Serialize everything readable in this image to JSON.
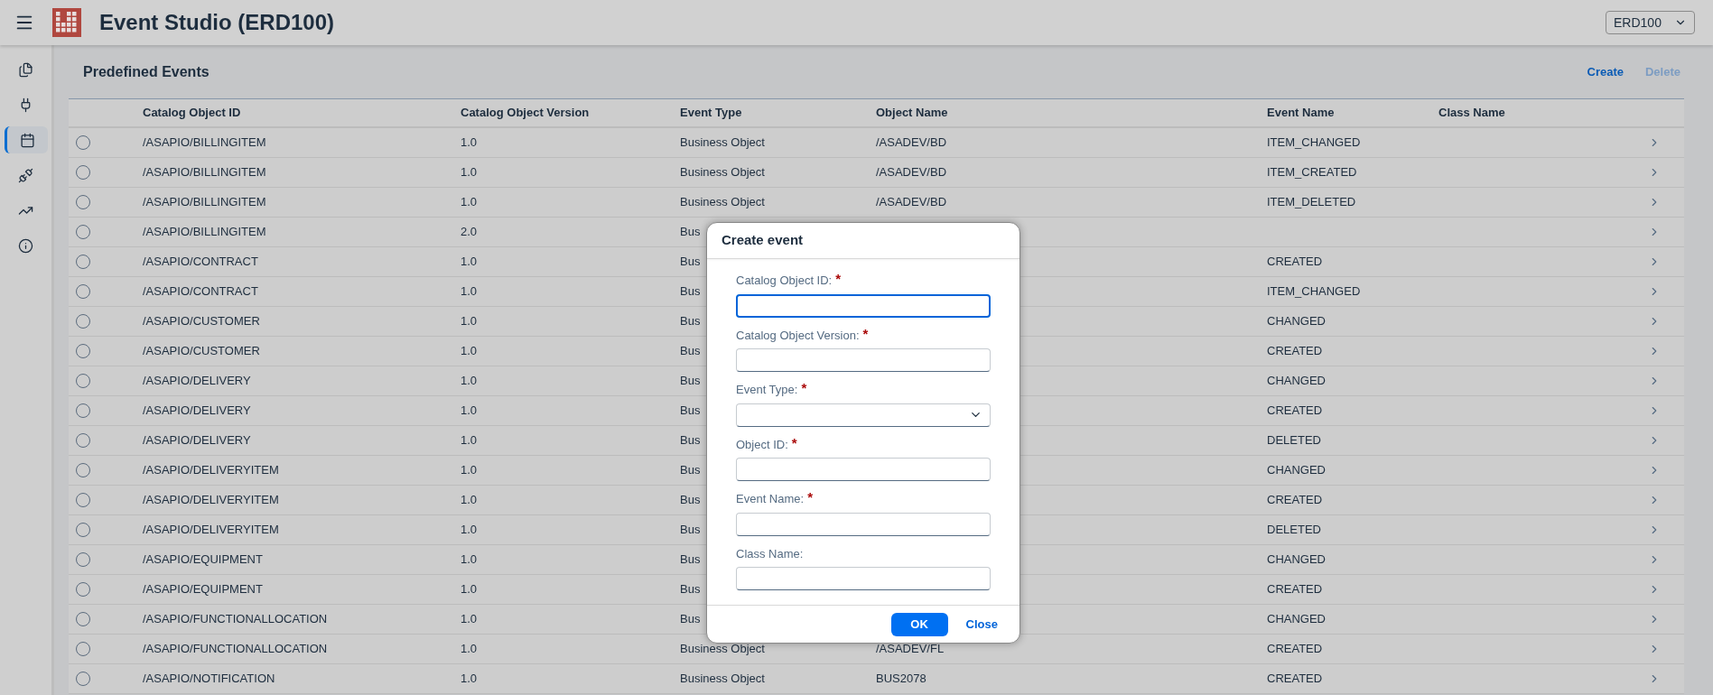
{
  "header": {
    "title": "Event Studio (ERD100)",
    "system": "ERD100"
  },
  "sidebar": {
    "items": [
      {
        "selected": false
      },
      {
        "selected": false
      },
      {
        "selected": true
      },
      {
        "selected": false
      },
      {
        "selected": false
      },
      {
        "selected": false
      }
    ]
  },
  "panel": {
    "title": "Predefined Events",
    "actions": [
      {
        "label": "Create",
        "disabled": false
      },
      {
        "label": "Delete",
        "disabled": true
      }
    ]
  },
  "table": {
    "columns": [
      "Catalog Object ID",
      "Catalog Object Version",
      "Event Type",
      "Object Name",
      "Event Name",
      "Class Name"
    ],
    "rows": [
      {
        "selected": false,
        "catalog_object_id": "/ASAPIO/BILLINGITEM",
        "version": "1.0",
        "event_type": "Business Object",
        "object_name": "/ASADEV/BD",
        "event_name": "ITEM_CHANGED"
      },
      {
        "selected": false,
        "catalog_object_id": "/ASAPIO/BILLINGITEM",
        "version": "1.0",
        "event_type": "Business Object",
        "object_name": "/ASADEV/BD",
        "event_name": "ITEM_CREATED"
      },
      {
        "selected": false,
        "catalog_object_id": "/ASAPIO/BILLINGITEM",
        "version": "1.0",
        "event_type": "Business Object",
        "object_name": "/ASADEV/BD",
        "event_name": "ITEM_DELETED"
      },
      {
        "selected": false,
        "catalog_object_id": "/ASAPIO/BILLINGITEM",
        "version": "2.0",
        "event_type": "Bus"
      },
      {
        "selected": false,
        "catalog_object_id": "/ASAPIO/CONTRACT",
        "version": "1.0",
        "event_type": "Bus",
        "event_name": "CREATED"
      },
      {
        "selected": false,
        "catalog_object_id": "/ASAPIO/CONTRACT",
        "version": "1.0",
        "event_type": "Bus",
        "event_name": "ITEM_CHANGED"
      },
      {
        "selected": false,
        "catalog_object_id": "/ASAPIO/CUSTOMER",
        "version": "1.0",
        "event_type": "Bus",
        "event_name": "CHANGED"
      },
      {
        "selected": false,
        "catalog_object_id": "/ASAPIO/CUSTOMER",
        "version": "1.0",
        "event_type": "Bus",
        "event_name": "CREATED"
      },
      {
        "selected": false,
        "catalog_object_id": "/ASAPIO/DELIVERY",
        "version": "1.0",
        "event_type": "Bus",
        "event_name": "CHANGED"
      },
      {
        "selected": false,
        "catalog_object_id": "/ASAPIO/DELIVERY",
        "version": "1.0",
        "event_type": "Bus",
        "event_name": "CREATED"
      },
      {
        "selected": false,
        "catalog_object_id": "/ASAPIO/DELIVERY",
        "version": "1.0",
        "event_type": "Bus",
        "event_name": "DELETED"
      },
      {
        "selected": false,
        "catalog_object_id": "/ASAPIO/DELIVERYITEM",
        "version": "1.0",
        "event_type": "Bus",
        "event_name": "CHANGED"
      },
      {
        "selected": false,
        "catalog_object_id": "/ASAPIO/DELIVERYITEM",
        "version": "1.0",
        "event_type": "Bus",
        "event_name": "CREATED"
      },
      {
        "selected": false,
        "catalog_object_id": "/ASAPIO/DELIVERYITEM",
        "version": "1.0",
        "event_type": "Bus",
        "event_name": "DELETED"
      },
      {
        "selected": false,
        "catalog_object_id": "/ASAPIO/EQUIPMENT",
        "version": "1.0",
        "event_type": "Bus",
        "event_name": "CHANGED"
      },
      {
        "selected": false,
        "catalog_object_id": "/ASAPIO/EQUIPMENT",
        "version": "1.0",
        "event_type": "Bus",
        "event_name": "CREATED"
      },
      {
        "selected": false,
        "catalog_object_id": "/ASAPIO/FUNCTIONALLOCATION",
        "version": "1.0",
        "event_type": "Bus",
        "event_name": "CHANGED"
      },
      {
        "selected": false,
        "catalog_object_id": "/ASAPIO/FUNCTIONALLOCATION",
        "version": "1.0",
        "event_type": "Business Object",
        "object_name": "/ASADEV/FL",
        "event_name": "CREATED"
      },
      {
        "selected": false,
        "catalog_object_id": "/ASAPIO/NOTIFICATION",
        "version": "1.0",
        "event_type": "Business Object",
        "object_name": "BUS2078",
        "event_name": "CREATED"
      }
    ]
  },
  "dialog": {
    "title": "Create event",
    "fields": [
      {
        "label": "Catalog Object ID:",
        "required_mark": "*",
        "kind": "text",
        "focused": true
      },
      {
        "label": "Catalog Object Version:",
        "required_mark": "*",
        "kind": "text",
        "focused": false
      },
      {
        "label": "Event Type:",
        "required_mark": "*",
        "kind": "select",
        "focused": false
      },
      {
        "label": "Object ID:",
        "required_mark": "*",
        "kind": "text",
        "focused": false
      },
      {
        "label": "Event Name:",
        "required_mark": "*",
        "kind": "text",
        "focused": false
      },
      {
        "label": "Class Name:",
        "kind": "text",
        "focused": false
      }
    ],
    "buttons": [
      {
        "label": "OK",
        "kind": "primary"
      },
      {
        "label": "Close",
        "kind": "link"
      }
    ]
  }
}
